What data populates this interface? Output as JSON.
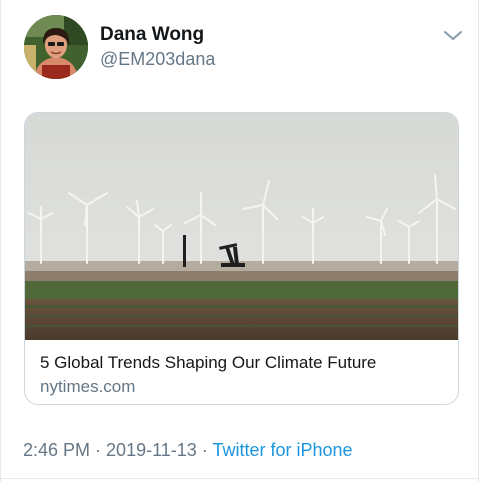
{
  "author": {
    "name": "Dana Wong",
    "handle": "@EM203dana",
    "avatar_icon": "profile-photo"
  },
  "menu": {
    "icon": "chevron-down-icon"
  },
  "link_card": {
    "title": "5 Global Trends Shaping Our Climate Future",
    "domain": "nytimes.com",
    "image_icon": "wind-turbines-photo"
  },
  "meta": {
    "time": "2:46 PM",
    "separator": " · ",
    "date": "2019-11-13",
    "source": "Twitter for iPhone"
  },
  "colors": {
    "text": "#14171a",
    "secondary": "#657786",
    "link": "#1b95e0",
    "border": "#ccd6dd"
  }
}
